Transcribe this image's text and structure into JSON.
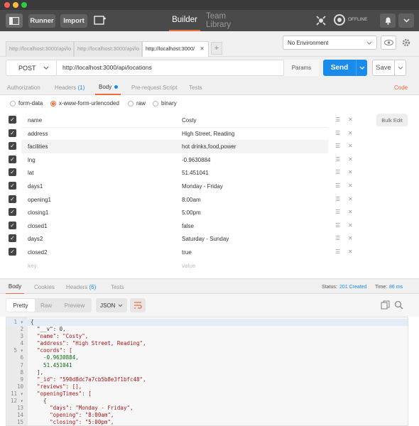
{
  "header": {
    "runner": "Runner",
    "import": "Import",
    "tab_builder": "Builder",
    "tab_team_library": "Team Library",
    "status": "OFFLINE"
  },
  "url_tabs": {
    "tabs": [
      "http://localhost:3000/api/lo",
      "http://localhost:3000/api/lo",
      "http://localhost:3000/"
    ],
    "new_tab": "+"
  },
  "environment": {
    "selected": "No Environment"
  },
  "request": {
    "method": "POST",
    "url": "http://localhost:3000/api/locations",
    "params": "Params",
    "send": "Send",
    "save": "Save"
  },
  "request_tabs": {
    "authorization": "Authorization",
    "headers": "Headers",
    "headers_count": "(1)",
    "body": "Body",
    "pre_request": "Pre-request Script",
    "tests": "Tests",
    "code": "Code"
  },
  "body_types": {
    "form_data": "form-data",
    "urlencoded": "x-www-form-urlencoded",
    "raw": "raw",
    "binary": "binary",
    "bulk_edit": "Bulk Edit"
  },
  "params": [
    {
      "key": "name",
      "value": "Costy"
    },
    {
      "key": "address",
      "value": "High Street, Reading"
    },
    {
      "key": "facilities",
      "value": "hot drinks,food,power"
    },
    {
      "key": "lng",
      "value": "-0.9630884"
    },
    {
      "key": "lat",
      "value": "51.451041"
    },
    {
      "key": "days1",
      "value": "Monday - Friday"
    },
    {
      "key": "opening1",
      "value": "8:00am"
    },
    {
      "key": "closing1",
      "value": "5:00pm"
    },
    {
      "key": "closed1",
      "value": "false"
    },
    {
      "key": "days2",
      "value": "Saturday - Sunday"
    },
    {
      "key": "closed2",
      "value": "true"
    }
  ],
  "param_placeholders": {
    "key": "key",
    "value": "value"
  },
  "response_tabs": {
    "body": "Body",
    "cookies": "Cookies",
    "headers": "Headers",
    "headers_count": "(6)",
    "tests": "Tests",
    "status_label": "Status:",
    "status_value": "201 Created",
    "time_label": "Time:",
    "time_value": "86 ms"
  },
  "response_view": {
    "pretty": "Pretty",
    "raw": "Raw",
    "preview": "Preview",
    "format": "JSON"
  },
  "code_lines": [
    "{",
    "  \"__v\": 0,",
    "  \"name\": \"Costy\",",
    "  \"address\": \"High Street, Reading\",",
    "  \"coords\": [",
    "    -0.9630884,",
    "    51.451041",
    "  ],",
    "  \"_id\": \"590d8dc7a7cb5b8e3f1bfc48\",",
    "  \"reviews\": [],",
    "  \"openingTimes\": [",
    "    {",
    "      \"days\": \"Monday - Friday\",",
    "      \"opening\": \"8:00am\",",
    "      \"closing\": \"5:00pm\","
  ],
  "colors": {
    "accent": "#f26b3a",
    "send": "#1a8bea",
    "header": "#4a4a4a",
    "status": "#1a8bea"
  }
}
